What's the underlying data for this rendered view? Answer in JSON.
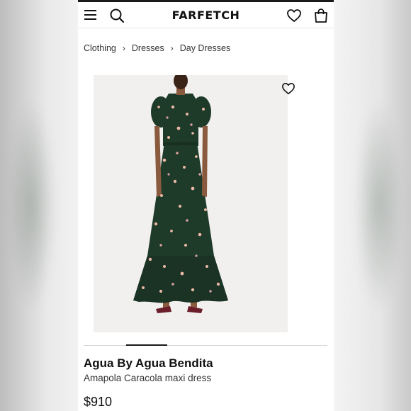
{
  "header": {
    "logo": "FARFETCH",
    "icons": [
      "menu-icon",
      "search-icon",
      "wishlist-icon",
      "bag-icon"
    ]
  },
  "breadcrumb": [
    "Clothing",
    "Dresses",
    "Day Dresses"
  ],
  "product": {
    "brand": "Agua By Agua Bendita",
    "name": "Amapola Caracola maxi dress",
    "price": "$910",
    "image_icon": "heart-outline-icon",
    "carousel_position": 0.2
  },
  "colors": {
    "text": "#111111",
    "dress_green": "#1e3a29",
    "image_bg": "#f1f0ef",
    "accent": "#1a1a1a"
  }
}
